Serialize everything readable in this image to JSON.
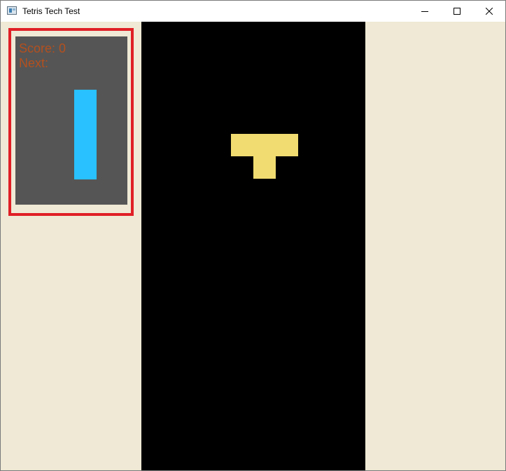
{
  "window": {
    "title": "Tetris Tech Test",
    "icon": "app-window-icon",
    "controls": [
      "minimize-icon",
      "maximize-icon",
      "close-icon"
    ]
  },
  "hud": {
    "score_label": "Score: 0",
    "next_label": "Next:",
    "label_color": "#b3501f",
    "panel_bg": "#555555",
    "highlight_border": "#e01f26",
    "next_piece": {
      "type": "I",
      "color": "#29c1ff",
      "orientation": "vertical"
    }
  },
  "board": {
    "columns": 10,
    "rows": 20,
    "background": "#000000",
    "active_piece": {
      "type": "T",
      "color": "#f0dc70",
      "cells": [
        [
          4,
          5
        ],
        [
          5,
          5
        ],
        [
          6,
          5
        ],
        [
          5,
          6
        ]
      ]
    }
  },
  "colors": {
    "window_bg": "#efe9d5",
    "titlebar_bg": "#ffffff"
  }
}
